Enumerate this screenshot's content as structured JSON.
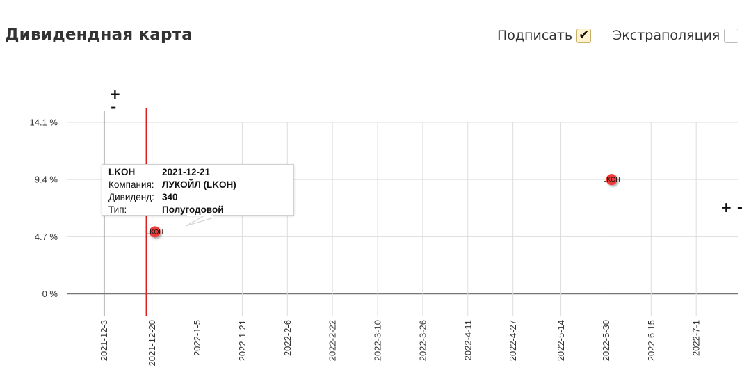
{
  "header": {
    "title": "Дивидендная карта",
    "sign_label": "Подписать",
    "sign_checked": true,
    "extrapolation_label": "Экстраполяция",
    "extrapolation_checked": false
  },
  "zoom": {
    "x_plus": "+",
    "x_minus": "-",
    "y_controls": "+ -"
  },
  "tooltip": {
    "ticker": "LKOH",
    "date": "2021-12-21",
    "company_label": "Компания:",
    "company": "ЛУКОЙЛ (LKOH)",
    "dividend_label": "Дивиденд:",
    "dividend": "340",
    "type_label": "Тип:",
    "type": "Полугодовой"
  },
  "colors": {
    "point": "#f03a3a",
    "cursor": "#e02020",
    "grid": "#dddddd",
    "axis": "#777777"
  },
  "chart_data": {
    "type": "scatter",
    "title": "",
    "xlabel": "",
    "ylabel": "",
    "x_ticks": [
      "2021-12-3",
      "2021-12-20",
      "2022-1-5",
      "2022-1-21",
      "2022-2-6",
      "2022-2-22",
      "2022-3-10",
      "2022-3-26",
      "2022-4-11",
      "2022-4-27",
      "2022-5-14",
      "2022-5-30",
      "2022-6-15",
      "2022-7-1"
    ],
    "y_ticks": [
      "0 %",
      "4.7 %",
      "9.4 %",
      "14.1 %"
    ],
    "xlim": [
      "2021-11-20",
      "2022-7-16"
    ],
    "ylim": [
      -1.8,
      14.1
    ],
    "grid": true,
    "cursor_x": "2021-12-18",
    "points": [
      {
        "x": "2021-12-21",
        "y": 5.1,
        "label": "LKOH"
      },
      {
        "x": "2022-6-1",
        "y": 9.4,
        "label": "LKOH"
      }
    ]
  }
}
